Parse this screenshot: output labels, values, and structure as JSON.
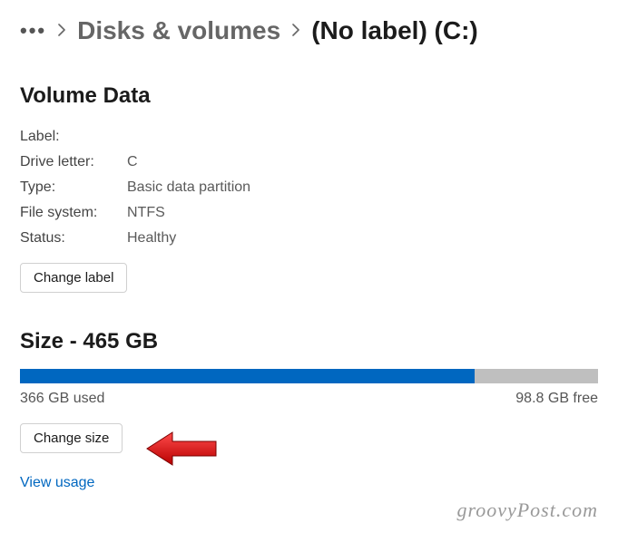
{
  "breadcrumb": {
    "parent": "Disks & volumes",
    "current": "(No label) (C:)"
  },
  "volume": {
    "heading": "Volume Data",
    "labels": {
      "label": "Label:",
      "drive_letter": "Drive letter:",
      "type": "Type:",
      "file_system": "File system:",
      "status": "Status:"
    },
    "values": {
      "label": "",
      "drive_letter": "C",
      "type": "Basic data partition",
      "file_system": "NTFS",
      "status": "Healthy"
    },
    "change_label_btn": "Change label"
  },
  "size": {
    "heading": "Size - 465 GB",
    "used_text": "366 GB used",
    "free_text": "98.8 GB free",
    "used_pct": 78.7,
    "change_size_btn": "Change size"
  },
  "view_usage_link": "View usage",
  "watermark": "groovyPost.com"
}
